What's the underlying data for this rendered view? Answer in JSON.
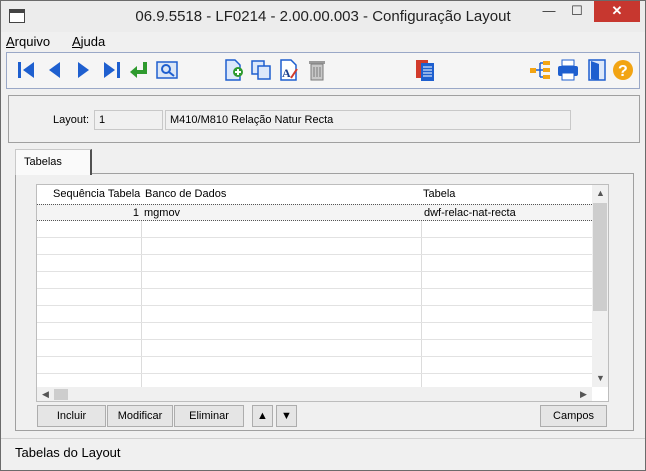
{
  "window": {
    "title": "06.9.5518 - LF0214 - 2.00.00.003 - Configuração Layout",
    "minimize": "—",
    "maximize": "☐",
    "close": "✕"
  },
  "menu": [
    {
      "label": "Arquivo",
      "accel": "A",
      "rest": "rquivo"
    },
    {
      "label": "Ajuda",
      "accel": "A",
      "rest": "juda"
    }
  ],
  "toolbar": {
    "icons": [
      "first-record-icon",
      "previous-record-icon",
      "next-record-icon",
      "last-record-icon",
      "return-icon",
      "search-icon",
      "new-document-icon",
      "copy-icon",
      "edit-text-icon",
      "delete-icon",
      "report-icon",
      "tree-icon",
      "print-icon",
      "exit-icon",
      "help-icon"
    ],
    "colors": {
      "nav_blue": "#1e5fcf",
      "green": "#2e9a2e",
      "help_orange": "#f2a413",
      "red": "#d23b2b"
    }
  },
  "layout": {
    "label": "Layout:",
    "code": "1",
    "description": "M410/M810 Relação Natur Recta"
  },
  "tab": {
    "label": "Tabelas"
  },
  "grid": {
    "headers": [
      "Sequência Tabela",
      "Banco de Dados",
      "Tabela"
    ],
    "rows": [
      {
        "seq": "1",
        "db": "mgmov",
        "table": "dwf-relac-nat-recta"
      }
    ],
    "empty_rows": 10
  },
  "buttons": {
    "incluir": "Incluir",
    "modificar": "Modificar",
    "eliminar": "Eliminar",
    "up": "▲",
    "down": "▼",
    "campos": "Campos"
  },
  "status": {
    "text": "Tabelas do Layout"
  }
}
